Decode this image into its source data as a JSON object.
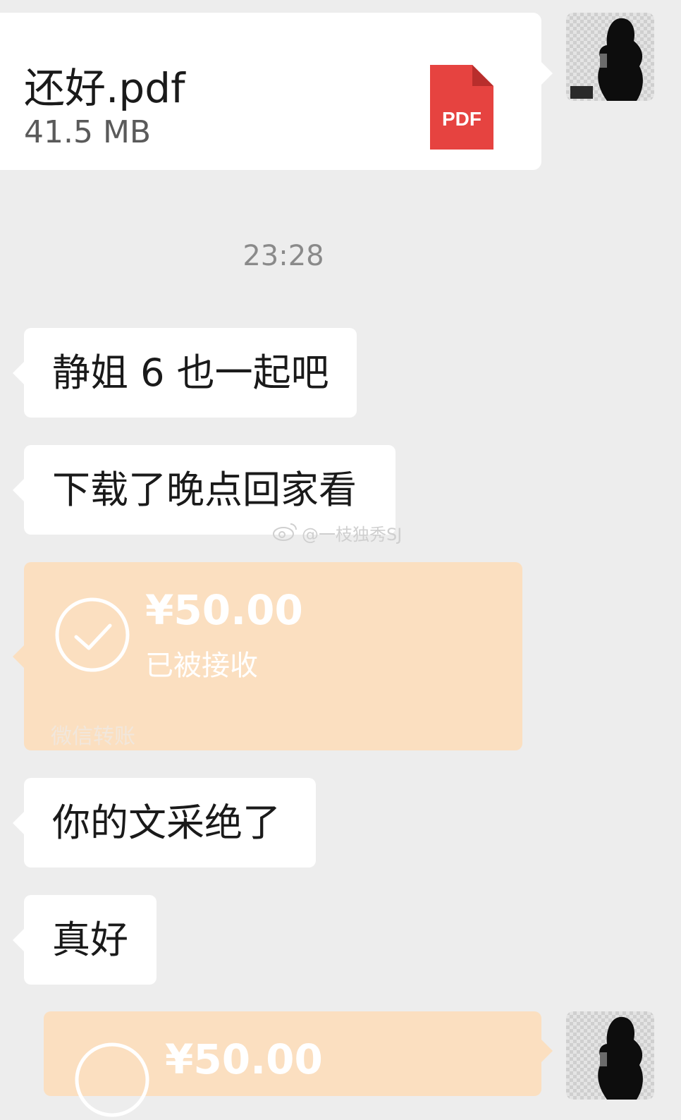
{
  "file_message": {
    "file_name": "还好.pdf",
    "file_size": "41.5 MB",
    "file_type_badge": "PDF"
  },
  "timestamp": "23:28",
  "messages": [
    {
      "text": "静姐 6 也一起吧"
    },
    {
      "text": "下载了晚点回家看"
    }
  ],
  "transfer_1": {
    "amount": "¥50.00",
    "status": "已被接收",
    "caption": "微信转账"
  },
  "messages_2": [
    {
      "text": "你的文采绝了"
    },
    {
      "text": "真好"
    }
  ],
  "transfer_2": {
    "amount": "¥50.00"
  },
  "watermark": "@一枝独秀SJ",
  "colors": {
    "background": "#ededed",
    "bubble": "#ffffff",
    "transfer": "#fbdfc0",
    "pdf_red": "#e64340"
  },
  "icons": [
    "pdf-icon",
    "check-circle-icon",
    "weibo-icon",
    "avatar-image"
  ]
}
